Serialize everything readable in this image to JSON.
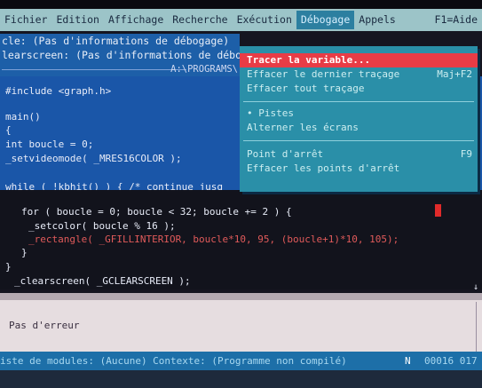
{
  "menu": {
    "items": [
      "Fichier",
      "Edition",
      "Affichage",
      "Recherche",
      "Exécution",
      "Débogage",
      "Appels",
      "F1=Aide"
    ],
    "active_index": 5
  },
  "info": {
    "line1": "cle: (Pas d'informations de débogage)",
    "line2": "learscreen: (Pas d'informations de débo",
    "path": "A:\\PROGRAMS\\"
  },
  "code": {
    "blue_lines": [
      "#include <graph.h>",
      "main()",
      "{",
      "   int boucle = 0;",
      "   _setvideomode( _MRES16COLOR );",
      "   while ( !kbhit() ) {   /* continue jusq"
    ],
    "dark_lines": [
      "for ( boucle = 0; boucle < 32; boucle += 2 ) {",
      "_setcolor( boucle % 16 );",
      "_rectangle( _GFILLINTERIOR, boucle*10, 95, (boucle+1)*10, 105);",
      "}",
      "}",
      "_clearscreen( _GCLEARSCREEN );"
    ],
    "scroll_marker": "↓"
  },
  "dropdown": {
    "items": [
      {
        "label": "Tracer la variable...",
        "key": "",
        "selected": true
      },
      {
        "label": "Effacer le dernier traçage",
        "key": "Maj+F2",
        "selected": false
      },
      {
        "label": "Effacer tout traçage",
        "key": "",
        "selected": false
      },
      {
        "label": "• Pistes",
        "key": "",
        "selected": false
      },
      {
        "label": "Alterner les écrans",
        "key": "",
        "selected": false
      },
      {
        "label": "Point d'arrêt",
        "key": "F9",
        "selected": false
      },
      {
        "label": "Effacer les points d'arrêt",
        "key": "",
        "selected": false
      }
    ]
  },
  "messages": {
    "text": "Pas d'erreur"
  },
  "status": {
    "left": "iste de modules: (Aucune) Contexte: (Programme non compilé)",
    "mode": "N",
    "position": "00016 017"
  },
  "colors": {
    "menubar": "#9cc4c8",
    "editor_blue": "#1a56a8",
    "editor_dark": "#12131c",
    "dropdown_bg": "#2a8fa8",
    "selected_item": "#e83c46",
    "status_bar": "#1d6fa8",
    "messages_bg": "#e6dde0"
  }
}
